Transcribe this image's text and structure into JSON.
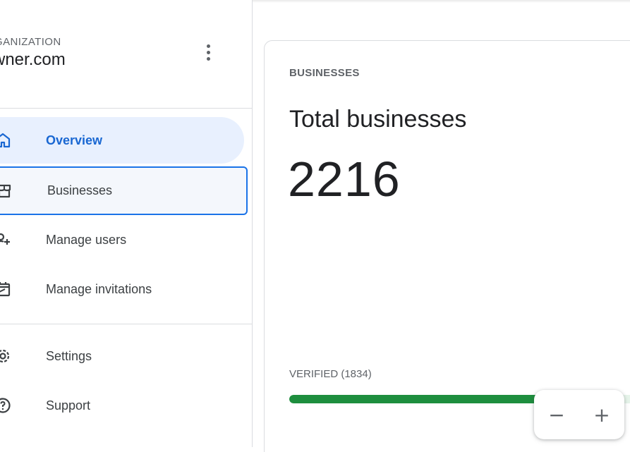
{
  "org": {
    "label": "GANIZATION",
    "name": "wner.com"
  },
  "nav": {
    "items": [
      {
        "label": "Overview",
        "icon": "home-icon"
      },
      {
        "label": "Businesses",
        "icon": "store-icon"
      },
      {
        "label": "Manage users",
        "icon": "add-user-icon"
      },
      {
        "label": "Manage invitations",
        "icon": "calendar-check-icon"
      },
      {
        "label": "Settings",
        "icon": "gear-icon"
      },
      {
        "label": "Support",
        "icon": "help-icon"
      }
    ]
  },
  "card": {
    "eyebrow": "BUSINESSES",
    "title": "Total businesses",
    "value": "2216",
    "verified_label": "VERIFIED (1834)",
    "verified_fraction": 0.8276
  },
  "zoom": {
    "minus": "−",
    "plus": "+"
  },
  "colors": {
    "accent": "#1a73e8",
    "active_bg": "#e8f0fe",
    "progress": "#1e8e3e"
  }
}
